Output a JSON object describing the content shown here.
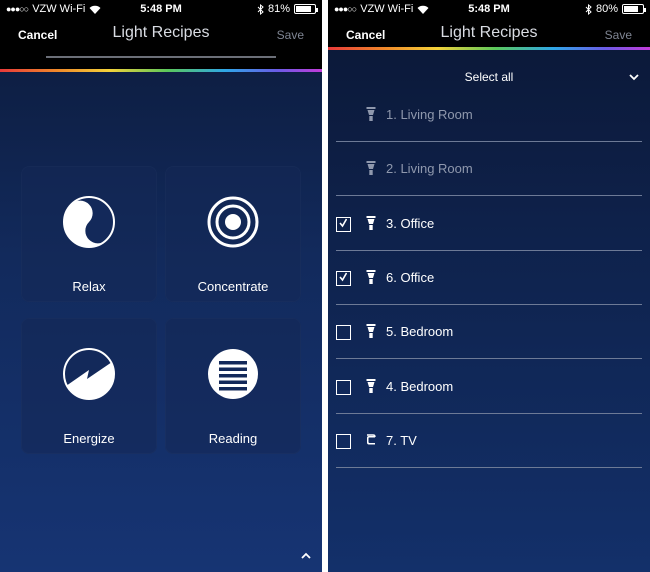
{
  "left_phone": {
    "status": {
      "carrier": "VZW Wi-Fi",
      "time": "5:48 PM",
      "battery": "81%",
      "battery_level": 0.81
    },
    "nav": {
      "cancel": "Cancel",
      "title": "Light Recipes",
      "save": "Save"
    },
    "recipes": [
      {
        "label": "Relax",
        "icon": "yin-yang-icon"
      },
      {
        "label": "Concentrate",
        "icon": "concentric-circles-icon"
      },
      {
        "label": "Energize",
        "icon": "lightning-bolt-icon"
      },
      {
        "label": "Reading",
        "icon": "horizontal-lines-icon"
      }
    ]
  },
  "right_phone": {
    "status": {
      "carrier": "VZW Wi-Fi",
      "time": "5:48 PM",
      "battery": "80%",
      "battery_level": 0.8
    },
    "nav": {
      "cancel": "Cancel",
      "title": "Light Recipes",
      "save": "Save"
    },
    "select_all": "Select all",
    "lights": [
      {
        "label": "1. Living Room",
        "checkbox": false,
        "checked": false,
        "icon": "bulb-icon",
        "dim": true
      },
      {
        "label": "2. Living Room",
        "checkbox": false,
        "checked": false,
        "icon": "bulb-icon",
        "dim": true
      },
      {
        "label": "3. Office",
        "checkbox": true,
        "checked": true,
        "icon": "bulb-icon",
        "dim": false
      },
      {
        "label": "6. Office",
        "checkbox": true,
        "checked": true,
        "icon": "bulb-icon",
        "dim": false
      },
      {
        "label": "5. Bedroom",
        "checkbox": true,
        "checked": false,
        "icon": "bulb-icon",
        "dim": false
      },
      {
        "label": "4. Bedroom",
        "checkbox": true,
        "checked": false,
        "icon": "bulb-icon",
        "dim": false
      },
      {
        "label": "7. TV",
        "checkbox": true,
        "checked": false,
        "icon": "lightstrip-icon",
        "dim": false
      }
    ]
  },
  "colors": {
    "accent_background": "#122a5c",
    "navbar": "#000000",
    "text": "#ffffff",
    "save_disabled": "#7f8593"
  }
}
